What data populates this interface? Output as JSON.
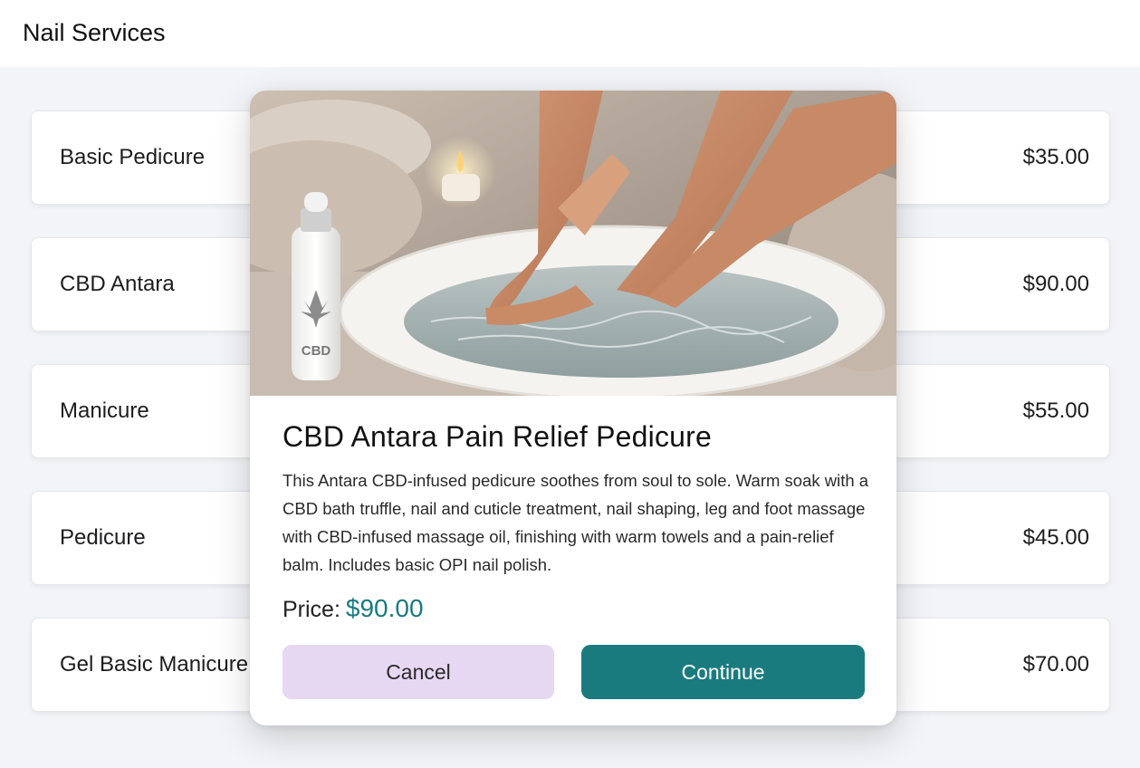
{
  "header": {
    "title": "Nail Services"
  },
  "services": [
    {
      "name": "Basic Pedicure",
      "price": "$35.00"
    },
    {
      "name": "CBD Antara",
      "price": "$90.00"
    },
    {
      "name": "Manicure",
      "price": "$55.00"
    },
    {
      "name": "Pedicure",
      "price": "$45.00"
    },
    {
      "name": "Gel Basic Manicure",
      "price": "$70.00"
    }
  ],
  "modal": {
    "image_label": "CBD",
    "title": "CBD Antara Pain Relief Pedicure",
    "description": "This Antara CBD-infused pedicure soothes from soul to sole. Warm soak with a CBD bath truffle, nail and cuticle treatment, nail shaping, leg and foot massage with CBD-infused massage oil, finishing with warm towels and a pain-relief balm. Includes basic OPI nail polish.",
    "price_label": "Price:",
    "price_value": "$90.00",
    "cancel_label": "Cancel",
    "continue_label": "Continue"
  },
  "colors": {
    "accent": "#197a80",
    "continue_bg": "#1a7b7f",
    "cancel_bg": "#e6d7f2"
  }
}
